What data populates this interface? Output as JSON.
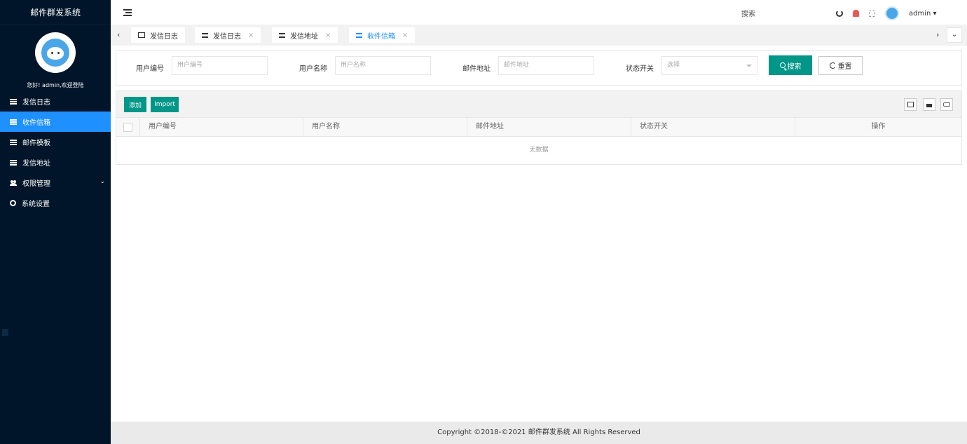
{
  "app": {
    "title": "邮件群发系统"
  },
  "sidebar": {
    "welcome": "您好! admin,欢迎登陆",
    "items": [
      {
        "label": "发信日志",
        "icon": "list-icon"
      },
      {
        "label": "收件信箱",
        "icon": "list-icon",
        "active": true
      },
      {
        "label": "邮件模板",
        "icon": "list-icon"
      },
      {
        "label": "发信地址",
        "icon": "list-icon"
      },
      {
        "label": "权限管理",
        "icon": "users-icon",
        "has_children": true
      },
      {
        "label": "系统设置",
        "icon": "gear-icon"
      }
    ]
  },
  "header": {
    "search_label": "搜索",
    "user": "admin ▾"
  },
  "tabs": {
    "prev": "‹",
    "next": "›",
    "menu": "⌄",
    "items": [
      {
        "label": "发信日志",
        "icon": "monitor-icon",
        "closable": false
      },
      {
        "label": "发信日志",
        "icon": "list-icon",
        "closable": true
      },
      {
        "label": "发信地址",
        "icon": "list-icon",
        "closable": true
      },
      {
        "label": "收件信箱",
        "icon": "list-icon",
        "closable": true,
        "active": true
      }
    ],
    "close_glyph": "×"
  },
  "search_form": {
    "user_id_label": "用户编号",
    "user_id_placeholder": "用户编号",
    "user_name_label": "用户名称",
    "user_name_placeholder": "用户名称",
    "email_label": "邮件地址",
    "email_placeholder": "邮件地址",
    "status_label": "状态开关",
    "status_placeholder": "选择",
    "search_button": "搜索",
    "reset_button": "重置"
  },
  "table": {
    "add_button": "添加",
    "import_button": "Import",
    "columns": [
      "用户编号",
      "用户名称",
      "邮件地址",
      "状态开关",
      "操作"
    ],
    "empty_text": "无数据"
  },
  "footer": {
    "copyright": "Copyright ©2018-©2021 邮件群发系统 All Rights Reserved"
  },
  "colors": {
    "sidebar_bg": "#001529",
    "active": "#1e90ff",
    "primary_btn": "#009688"
  }
}
